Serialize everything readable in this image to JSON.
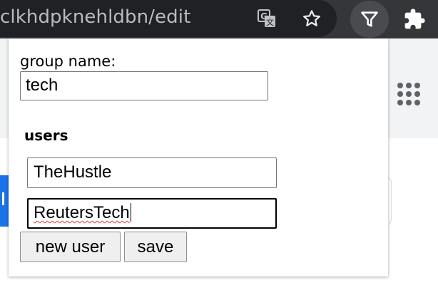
{
  "browser": {
    "url": "clkhdpknehldbn/edit",
    "icons": {
      "translate": "translate-icon",
      "bookmark": "star-icon",
      "extension_active": "filter-icon",
      "extensions_menu": "puzzle-icon"
    }
  },
  "page": {
    "apps_icon": "apps-grid-icon",
    "accent_color": "#1a73e8"
  },
  "popup": {
    "group_name_label": "group name:",
    "group_name_value": "tech",
    "users_heading": "users",
    "users": [
      "TheHustle",
      "ReutersTech"
    ],
    "new_user_button": "new user",
    "save_button": "save"
  }
}
